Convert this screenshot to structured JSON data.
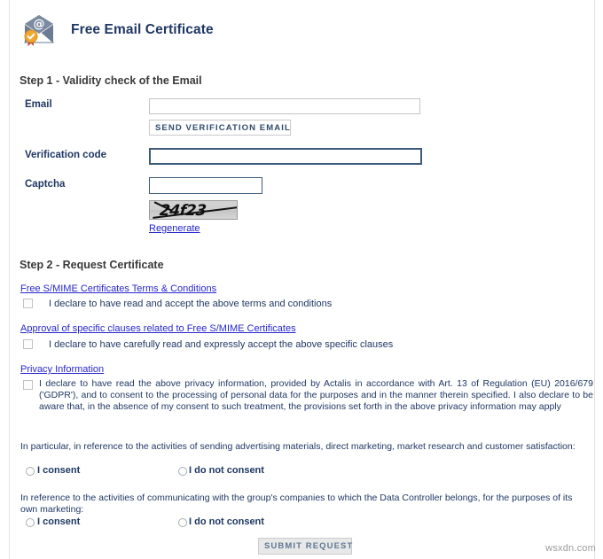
{
  "header": {
    "title": "Free Email Certificate",
    "icon": "email-certificate-icon"
  },
  "step1": {
    "heading": "Step 1 - Validity check of the Email",
    "email": {
      "label": "Email",
      "value": "",
      "placeholder": ""
    },
    "send_button": "SEND VERIFICATION EMAIL",
    "verification_code": {
      "label": "Verification code",
      "value": "",
      "placeholder": ""
    },
    "captcha": {
      "label": "Captcha",
      "value": "",
      "placeholder": "",
      "image_text": "24f23",
      "regenerate_link": "Regenerate"
    }
  },
  "step2": {
    "heading": "Step 2 - Request Certificate",
    "consents": [
      {
        "link": "Free S/MIME Certificates Terms & Conditions",
        "declaration": "I declare to have read and accept the above terms and conditions",
        "checked": false
      },
      {
        "link": "Approval of specific clauses related to Free S/MIME Certificates",
        "declaration": "I declare to have carefully read and expressly accept the above specific clauses",
        "checked": false
      },
      {
        "link": "Privacy Information",
        "declaration": "I declare to have read the above privacy information, provided by Actalis in accordance with Art. 13 of Regulation (EU) 2016/679 ('GDPR'), and to consent to the processing of personal data for the purposes and in the manner therein specified. I also declare to be aware that, in the absence of my consent to such treatment, the provisions set forth in the above privacy information may apply",
        "checked": false
      }
    ],
    "marketing_consent": {
      "question": "In particular, in reference to the activities of sending advertising materials, direct marketing, market research and customer satisfaction:",
      "option_yes": "I consent",
      "option_no": "I do not consent",
      "selected": ""
    },
    "group_consent": {
      "question": "In reference to the activities of communicating with the group's companies to which the Data Controller belongs, for the purposes of its own marketing:",
      "option_yes": "I consent",
      "option_no": "I do not consent",
      "selected": ""
    },
    "submit_button": "SUBMIT REQUEST"
  },
  "watermark": "wsxdn.com",
  "colors": {
    "link": "#2222cc",
    "label": "#1f3864",
    "heading": "#3a3a3a",
    "input_border_active": "#3d5a7a",
    "input_border": "#c3c3c3",
    "submit_bg": "#e8e8e8",
    "seal": "#f0a830"
  }
}
